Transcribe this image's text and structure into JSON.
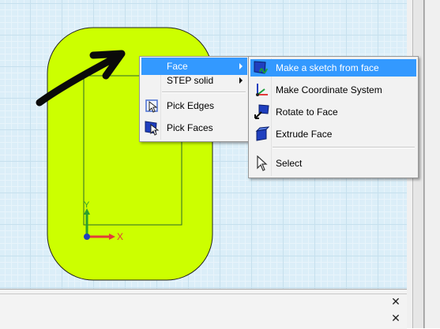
{
  "context_menu": {
    "items": [
      {
        "label": "Face",
        "has_submenu": true,
        "highlighted": true
      },
      {
        "label": "STEP solid",
        "has_submenu": true
      },
      {
        "label": "Pick Edges",
        "icon": "pick-edges-icon"
      },
      {
        "label": "Pick Faces",
        "icon": "pick-faces-icon"
      }
    ]
  },
  "face_submenu": {
    "items": [
      {
        "label": "Make a sketch from face",
        "icon": "sketch-from-face-icon",
        "highlighted": true
      },
      {
        "label": "Make Coordinate System",
        "icon": "coordinate-system-icon"
      },
      {
        "label": "Rotate to Face",
        "icon": "rotate-to-face-icon"
      },
      {
        "label": "Extrude Face",
        "icon": "extrude-face-icon"
      },
      {
        "label": "Select",
        "icon": "select-cursor-icon"
      }
    ]
  },
  "axes": {
    "y_label": "Y",
    "x_label": "X"
  },
  "panel": {
    "close_symbol": "✕"
  },
  "colors": {
    "face_fill": "#ccff00",
    "highlight": "#3399ff",
    "viewport_bg": "#dbeef8"
  }
}
